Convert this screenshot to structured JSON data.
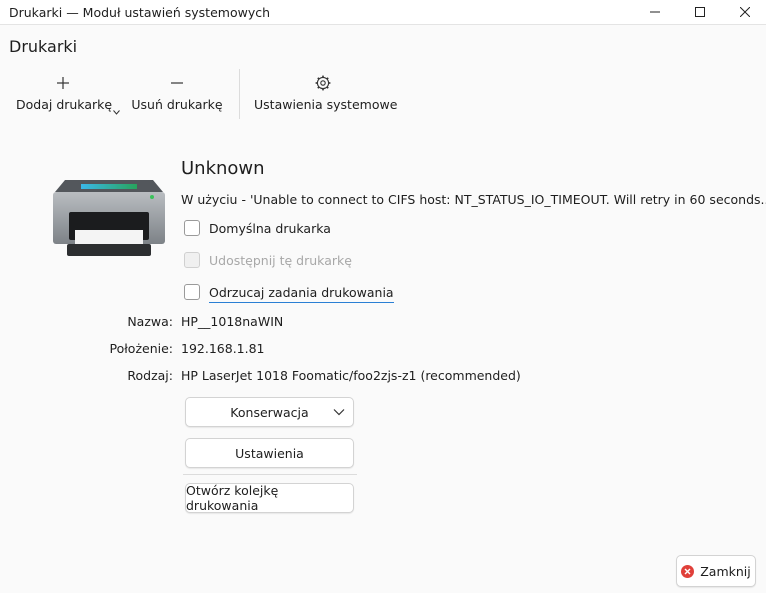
{
  "window": {
    "title": "Drukarki — Moduł ustawień systemowych",
    "controls": {
      "minimize": "minimize-icon",
      "maximize": "maximize-icon",
      "close": "close-icon"
    }
  },
  "page": {
    "heading": "Drukarki"
  },
  "toolbar": {
    "add_label": "Dodaj drukarkę",
    "remove_label": "Usuń drukarkę",
    "settings_label": "Ustawienia systemowe"
  },
  "printer": {
    "name": "Unknown",
    "status": "W użyciu - 'Unable to connect to CIFS host: NT_STATUS_IO_TIMEOUT. Will retry in 60 seconds...'",
    "options": {
      "default_label": "Domyślna drukarka",
      "share_label": "Udostępnij tę drukarkę",
      "reject_label": "Odrzucaj zadania drukowania"
    },
    "fields": {
      "name_label": "Nazwa:",
      "name_value": "HP__1018naWIN",
      "location_label": "Położenie:",
      "location_value": "192.168.1.81",
      "type_label": "Rodzaj:",
      "type_value": "HP LaserJet 1018 Foomatic/foo2zjs-z1 (recommended)"
    }
  },
  "buttons": {
    "maintenance": "Konserwacja",
    "settings": "Ustawienia",
    "open_queue": "Otwórz kolejkę drukowania",
    "close": "Zamknij"
  },
  "colors": {
    "accent": "#2a7fd4",
    "close_icon": "#e0403a",
    "printer_body": "#8c9095"
  }
}
